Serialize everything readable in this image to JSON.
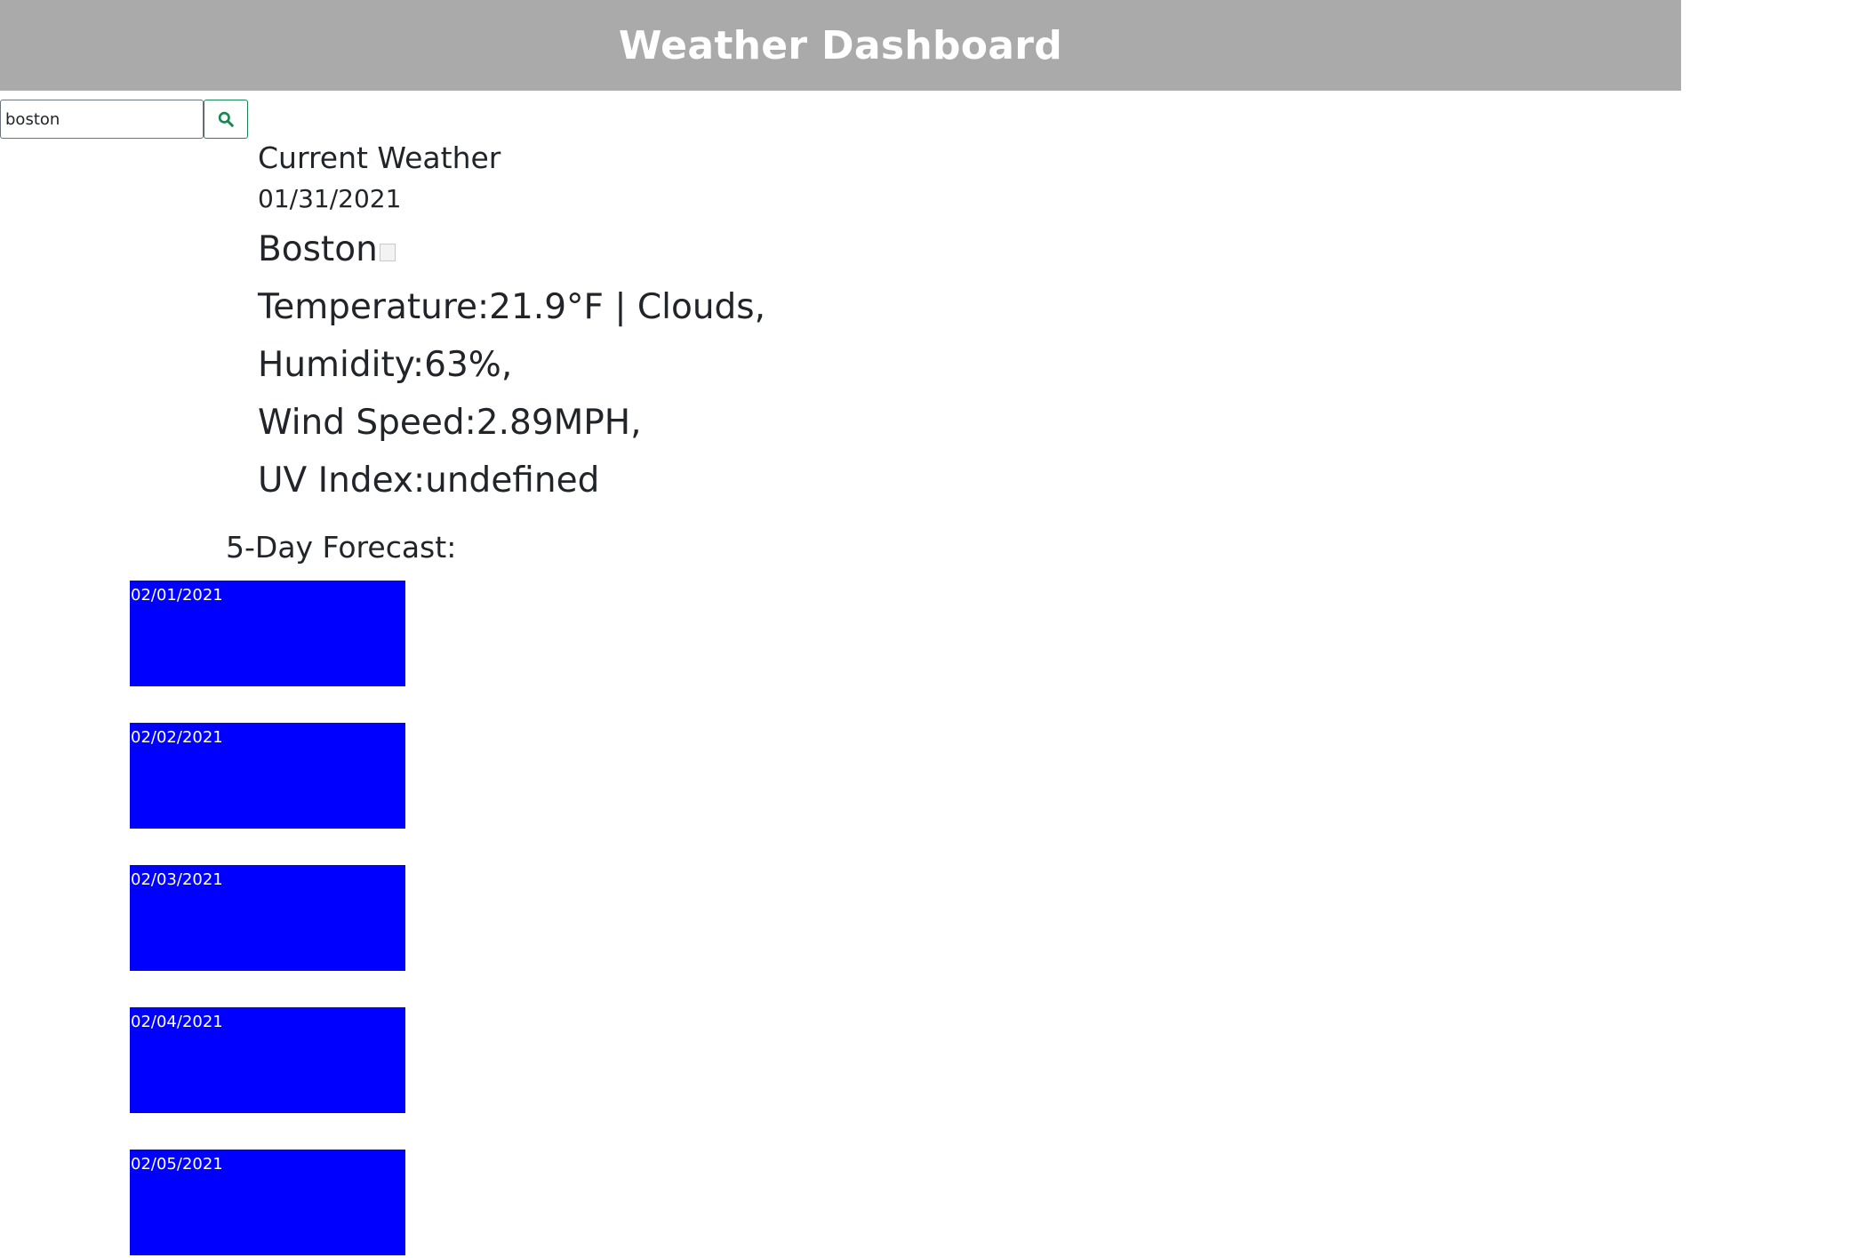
{
  "header": {
    "title": "Weather Dashboard"
  },
  "search": {
    "value": "boston",
    "button_icon": "search-icon",
    "button_color": "#198754"
  },
  "current": {
    "title": "Current Weather",
    "date": "01/31/2021",
    "city": "Boston",
    "temperature": "Temperature:21.9°F | Clouds,",
    "humidity": "Humidity:63%,",
    "wind_speed": "Wind Speed:2.89MPH,",
    "uv_index": "UV Index:undefined"
  },
  "forecast": {
    "heading": "5-Day Forecast:",
    "card_color": "#0000ff",
    "days": [
      {
        "date": "02/01/2021"
      },
      {
        "date": "02/02/2021"
      },
      {
        "date": "02/03/2021"
      },
      {
        "date": "02/04/2021"
      },
      {
        "date": "02/05/2021"
      }
    ]
  }
}
